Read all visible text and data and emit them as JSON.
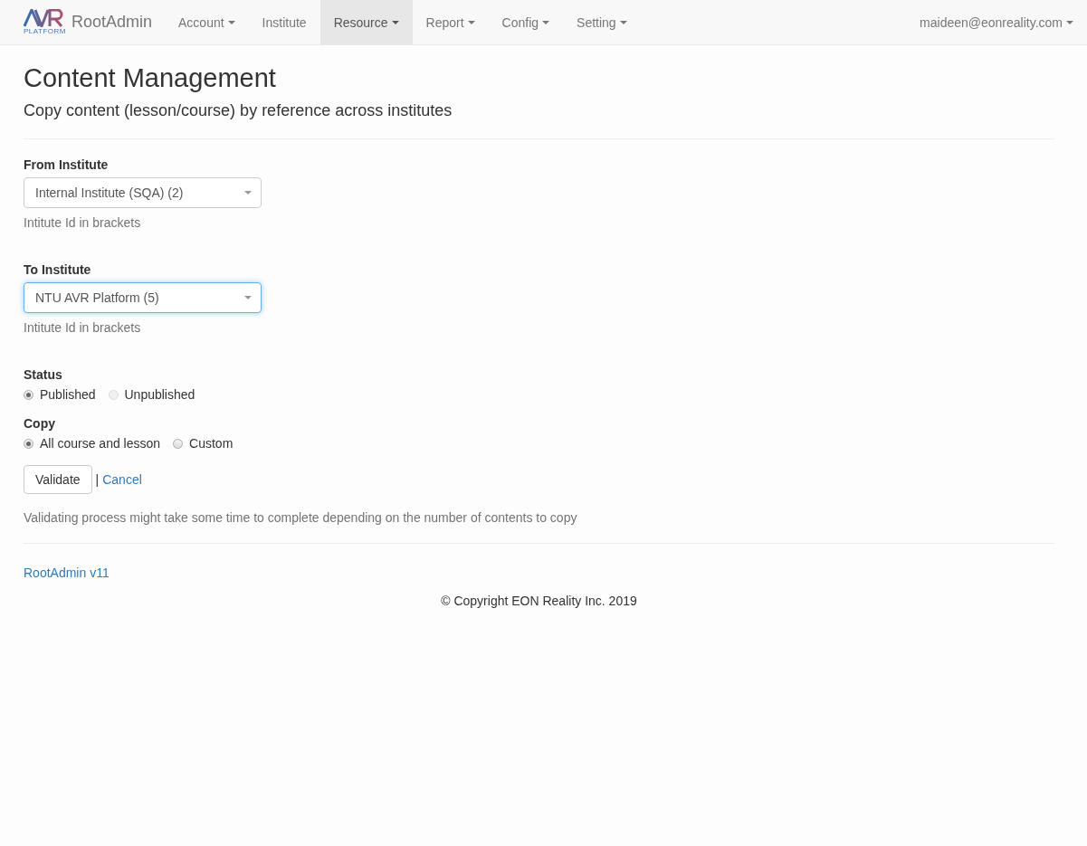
{
  "navbar": {
    "logo_caption": "PLATFORM",
    "brand": "RootAdmin",
    "items": [
      {
        "label": "Account",
        "dropdown": true,
        "selected": false
      },
      {
        "label": "Institute",
        "dropdown": false,
        "selected": false
      },
      {
        "label": "Resource",
        "dropdown": true,
        "selected": true
      },
      {
        "label": "Report",
        "dropdown": true,
        "selected": false
      },
      {
        "label": "Config",
        "dropdown": true,
        "selected": false
      },
      {
        "label": "Setting",
        "dropdown": true,
        "selected": false
      }
    ],
    "user": {
      "label": "maideen@eonreality.com",
      "dropdown": true
    }
  },
  "page": {
    "title": "Content Management",
    "subtitle": "Copy content (lesson/course) by reference across institutes"
  },
  "form": {
    "fields": [
      {
        "label": "From Institute",
        "value": "Internal Institute (SQA) (2)",
        "focused": false,
        "help": "Intitute Id in brackets"
      },
      {
        "label": "To Institute",
        "value": "NTU AVR Platform (5)",
        "focused": true,
        "help": "Intitute Id in brackets"
      }
    ],
    "radio_groups": [
      {
        "label": "Status",
        "options": [
          {
            "label": "Published",
            "selected": true,
            "disabled": false
          },
          {
            "label": "Unpublished",
            "selected": false,
            "disabled": true
          }
        ]
      },
      {
        "label": "Copy",
        "options": [
          {
            "label": "All course and lesson",
            "selected": true,
            "disabled": false
          },
          {
            "label": "Custom",
            "selected": false,
            "disabled": false
          }
        ]
      }
    ],
    "validate_button": "Validate",
    "separator": "|",
    "cancel_link": "Cancel",
    "note": "Validating process might take some time to complete depending on the number of contents to copy"
  },
  "footer": {
    "version_link": "RootAdmin v11",
    "copyright": "© Copyright EON Reality Inc. 2019"
  }
}
